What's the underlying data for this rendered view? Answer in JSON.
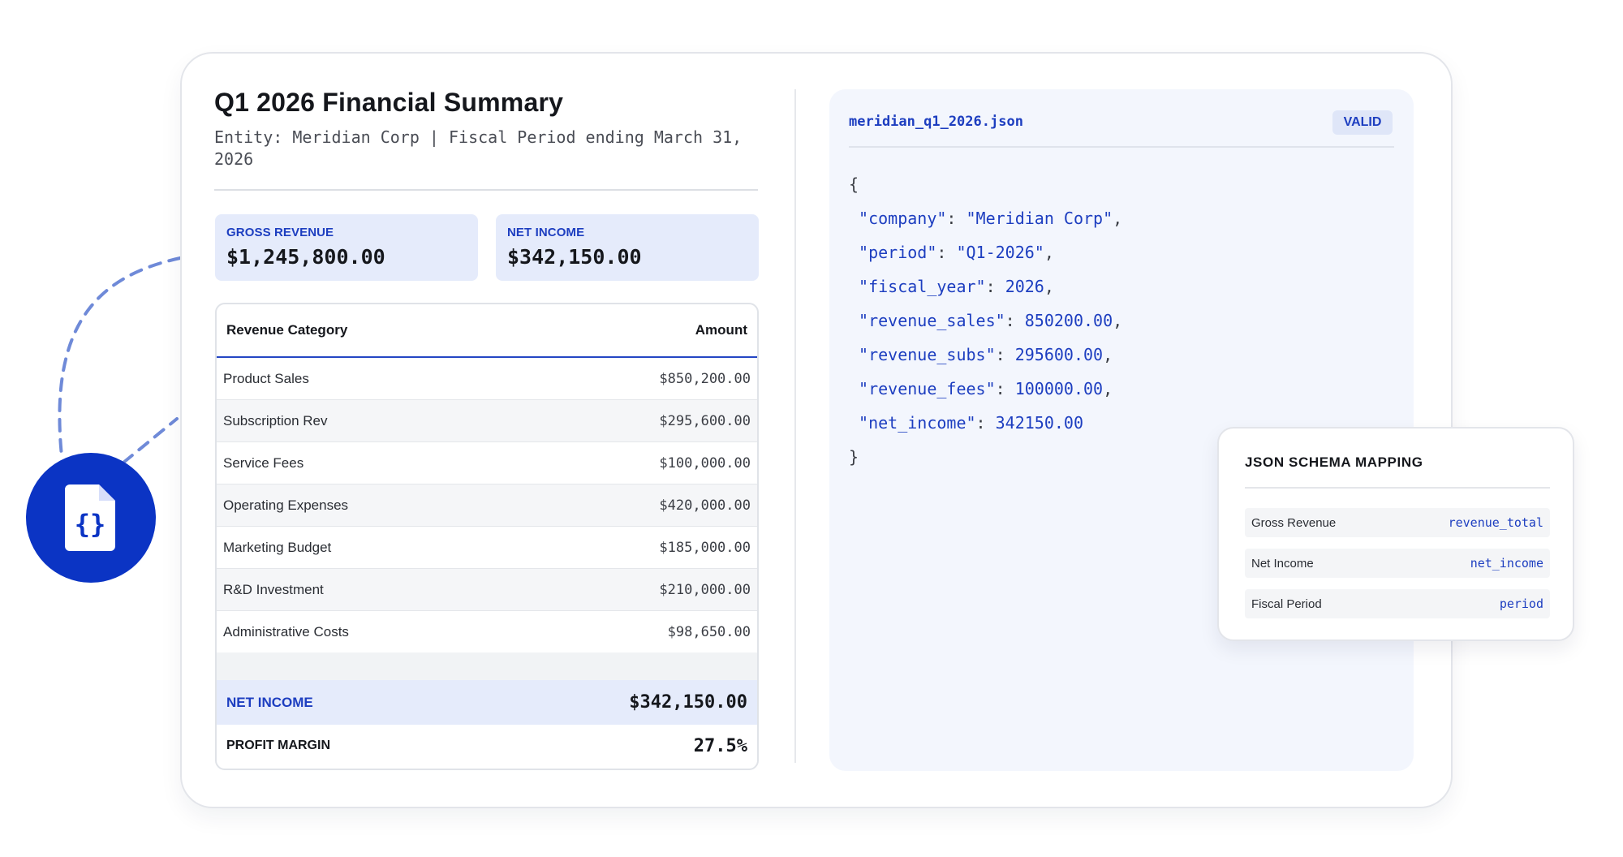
{
  "document": {
    "title": "Q1 2026 Financial Summary",
    "subtitle": "Entity: Meridian Corp | Fiscal Period ending March 31, 2026"
  },
  "kpis": [
    {
      "label": "GROSS REVENUE",
      "value": "$1,245,800.00"
    },
    {
      "label": "NET INCOME",
      "value": "$342,150.00"
    }
  ],
  "table": {
    "headers": {
      "category": "Revenue Category",
      "amount": "Amount"
    },
    "rows": [
      {
        "category": "Product Sales",
        "amount": "$850,200.00"
      },
      {
        "category": "Subscription Rev",
        "amount": "$295,600.00"
      },
      {
        "category": "Service Fees",
        "amount": "$100,000.00"
      },
      {
        "category": "Operating Expenses",
        "amount": "$420,000.00"
      },
      {
        "category": "Marketing Budget",
        "amount": "$185,000.00"
      },
      {
        "category": "R&D Investment",
        "amount": "$210,000.00"
      },
      {
        "category": "Administrative Costs",
        "amount": "$98,650.00"
      }
    ],
    "net_income": {
      "label": "NET INCOME",
      "value": "$342,150.00"
    },
    "profit_margin": {
      "label": "PROFIT MARGIN",
      "value": "27.5%"
    }
  },
  "json_panel": {
    "filename": "meridian_q1_2026.json",
    "status": "VALID",
    "open_brace": "{",
    "close_brace": "}",
    "lines": [
      {
        "key": "\"company\"",
        "value": "\"Meridian Corp\"",
        "comma": ","
      },
      {
        "key": "\"period\"",
        "value": "\"Q1-2026\"",
        "comma": ","
      },
      {
        "key": "\"fiscal_year\"",
        "value": "2026",
        "comma": ","
      },
      {
        "key": "\"revenue_sales\"",
        "value": "850200.00",
        "comma": ","
      },
      {
        "key": "\"revenue_subs\"",
        "value": "295600.00",
        "comma": ","
      },
      {
        "key": "\"revenue_fees\"",
        "value": "100000.00",
        "comma": ","
      },
      {
        "key": "\"net_income\"",
        "value": "342150.00",
        "comma": ""
      }
    ]
  },
  "mapping": {
    "title": "JSON SCHEMA MAPPING",
    "rows": [
      {
        "label": "Gross Revenue",
        "field": "revenue_total"
      },
      {
        "label": "Net Income",
        "field": "net_income"
      },
      {
        "label": "Fiscal Period",
        "field": "period"
      }
    ]
  },
  "icons": {
    "file_badge": "json-file-icon"
  },
  "colors": {
    "accent": "#1d3ec0",
    "badge_circle": "#0b34c4",
    "kpi_bg": "#e5ebfb",
    "code_bg": "#f3f6fd"
  }
}
